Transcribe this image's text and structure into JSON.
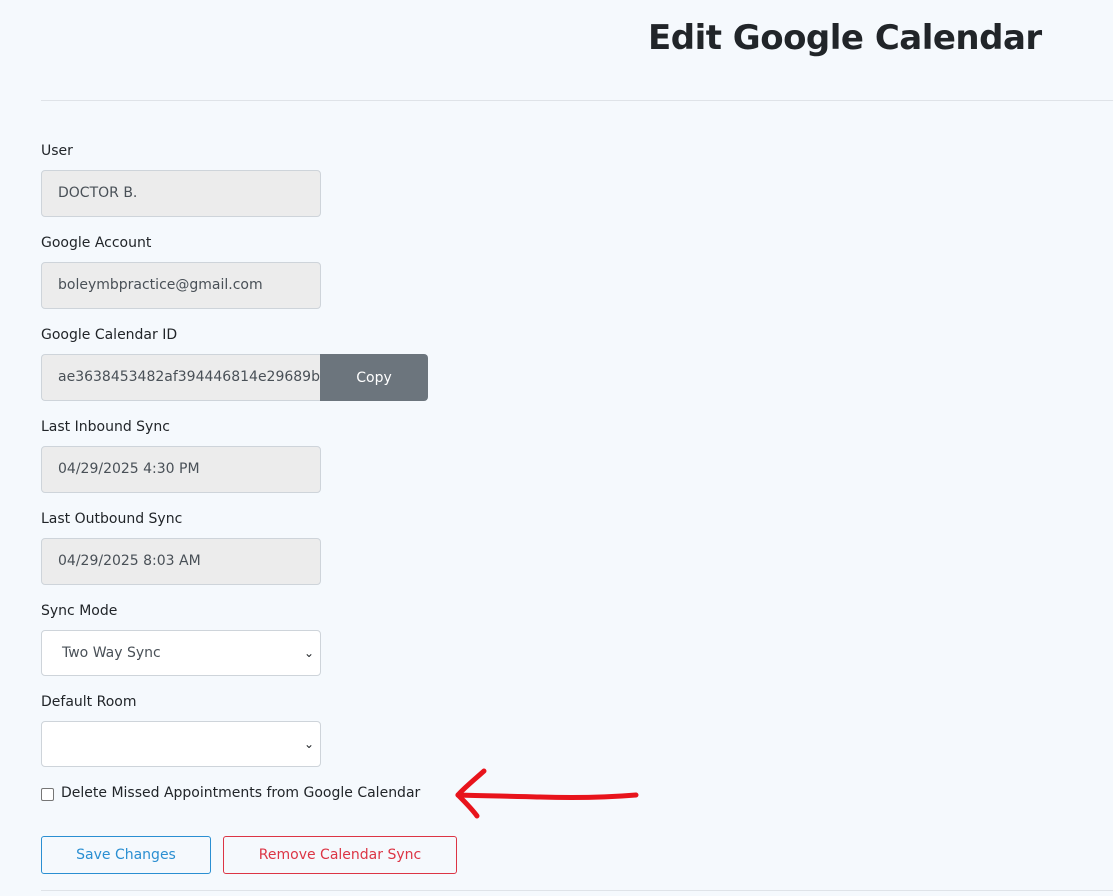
{
  "header": {
    "title": "Edit Google Calendar"
  },
  "form": {
    "user": {
      "label": "User",
      "value": "DOCTOR B."
    },
    "google_account": {
      "label": "Google Account",
      "value": "boleymbpractice@gmail.com"
    },
    "calendar_id": {
      "label": "Google Calendar ID",
      "value": "ae3638453482af394446814e29689b",
      "copy_label": "Copy"
    },
    "last_inbound": {
      "label": "Last Inbound Sync",
      "value": "04/29/2025 4:30 PM"
    },
    "last_outbound": {
      "label": "Last Outbound Sync",
      "value": "04/29/2025 8:03 AM"
    },
    "sync_mode": {
      "label": "Sync Mode",
      "selected": "Two Way Sync"
    },
    "default_room": {
      "label": "Default Room",
      "selected": ""
    },
    "delete_missed": {
      "label": "Delete Missed Appointments from Google Calendar",
      "checked": false
    }
  },
  "actions": {
    "save_label": "Save Changes",
    "remove_label": "Remove Calendar Sync"
  },
  "annotation": {
    "color": "#e8141c",
    "icon": "red-arrow-annotation"
  },
  "colors": {
    "save": "#2a8fd2",
    "remove": "#dc3545",
    "copy_bg": "#6c757d"
  }
}
